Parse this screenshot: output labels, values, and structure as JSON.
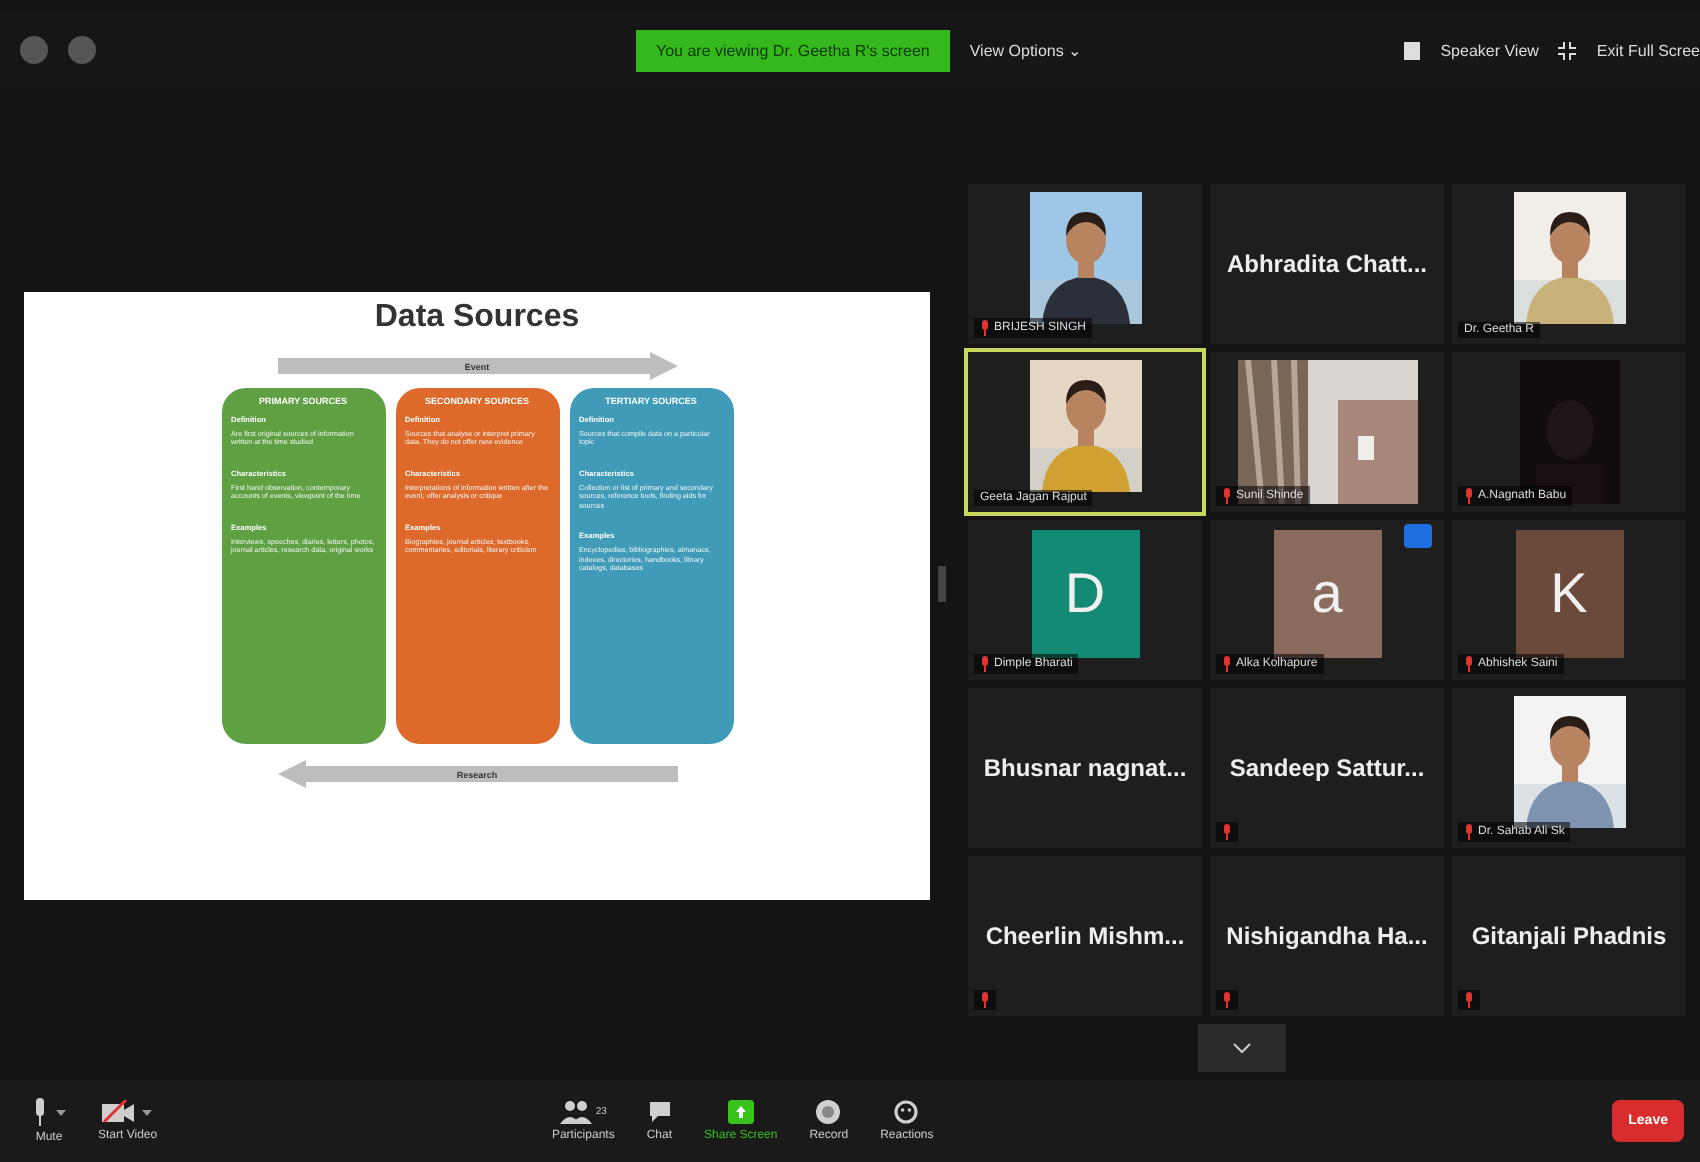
{
  "top_bar": {
    "banner": "You are viewing Dr. Geetha R's screen",
    "view_options": "View Options ⌄",
    "speaker_view": "Speaker View",
    "exit_full_screen": "Exit Full Scree"
  },
  "slide": {
    "title": "Data Sources",
    "top_arrow": "Event",
    "bottom_arrow": "Research",
    "columns": [
      {
        "title": "PRIMARY SOURCES",
        "color": "#5fa043",
        "sections": [
          {
            "heading": "Definition",
            "body": "Are first original sources of information written at the time studied"
          },
          {
            "heading": "Characteristics",
            "body": "First hand observation, contemporary accounts of events, viewpoint of the time"
          },
          {
            "heading": "Examples",
            "body": "Interviews, speeches, diaries, letters, photos, journal articles, research data, original works"
          }
        ]
      },
      {
        "title": "SECONDARY SOURCES",
        "color": "#dd6a2a",
        "sections": [
          {
            "heading": "Definition",
            "body": "Sources that analyse or interpret primary data. They do not offer new evidence"
          },
          {
            "heading": "Characteristics",
            "body": "Interpretations of information written after the event, offer analysis or critique"
          },
          {
            "heading": "Examples",
            "body": "Biographies, journal articles, textbooks, commentaries, editorials, literary criticism"
          }
        ]
      },
      {
        "title": "TERTIARY SOURCES",
        "color": "#3f9bb8",
        "sections": [
          {
            "heading": "Definition",
            "body": "Sources that compile data on a particular topic"
          },
          {
            "heading": "Characteristics",
            "body": "Collection or list of primary and secondary sources, reference tools, finding aids for sources"
          },
          {
            "heading": "Examples",
            "body": "Encyclopedias, bibliographies, almanacs, indexes, directories, handbooks, library catalogs, databases"
          }
        ]
      }
    ]
  },
  "gallery": [
    {
      "kind": "video",
      "name": "BRIJESH SINGH",
      "muted": true,
      "active": false
    },
    {
      "kind": "name",
      "name": "Abhradita  Chatt...",
      "muted": false,
      "active": false
    },
    {
      "kind": "video",
      "name": "Dr. Geetha R",
      "muted": false,
      "active": false
    },
    {
      "kind": "video",
      "name": "Geeta Jagan Rajput",
      "muted": false,
      "active": true
    },
    {
      "kind": "video",
      "name": "Sunil Shinde",
      "muted": true,
      "active": false
    },
    {
      "kind": "video",
      "name": "A.Nagnath Babu",
      "muted": true,
      "active": false
    },
    {
      "kind": "avatar",
      "letter": "D",
      "color": "#138a74",
      "name": "Dimple Bharati",
      "muted": true,
      "active": false
    },
    {
      "kind": "avatar",
      "letter": "a",
      "color": "#8a6b5e",
      "name": "Alka Kolhapure",
      "muted": true,
      "active": false,
      "badge": true
    },
    {
      "kind": "avatar",
      "letter": "K",
      "color": "#6b4a3c",
      "name": "Abhishek Saini",
      "muted": true,
      "active": false
    },
    {
      "kind": "name",
      "name": "Bhusnar  nagnat...",
      "muted": false,
      "active": false
    },
    {
      "kind": "name",
      "name": "Sandeep  Sattur...",
      "muted": true,
      "active": false
    },
    {
      "kind": "video",
      "name": "Dr. Sahab Ali Sk",
      "muted": true,
      "active": false
    },
    {
      "kind": "name",
      "name": "Cheerlin  Mishm...",
      "muted": true,
      "active": false
    },
    {
      "kind": "name",
      "name": "Nishigandha  Ha...",
      "muted": true,
      "active": false
    },
    {
      "kind": "name",
      "name": "Gitanjali Phadnis",
      "muted": true,
      "active": false
    }
  ],
  "toolbar": {
    "left": [
      {
        "kind": "mic",
        "label": "Mute"
      },
      {
        "kind": "video",
        "label": "Start Video"
      }
    ],
    "center": [
      {
        "kind": "participants",
        "label": "Participants",
        "count": "23",
        "highlight": false
      },
      {
        "kind": "chat",
        "label": "Chat",
        "highlight": false
      },
      {
        "kind": "share",
        "label": "Share Screen",
        "highlight": true
      },
      {
        "kind": "record",
        "label": "Record",
        "highlight": false
      },
      {
        "kind": "reactions",
        "label": "Reactions",
        "highlight": false
      }
    ],
    "leave": "Leave"
  }
}
